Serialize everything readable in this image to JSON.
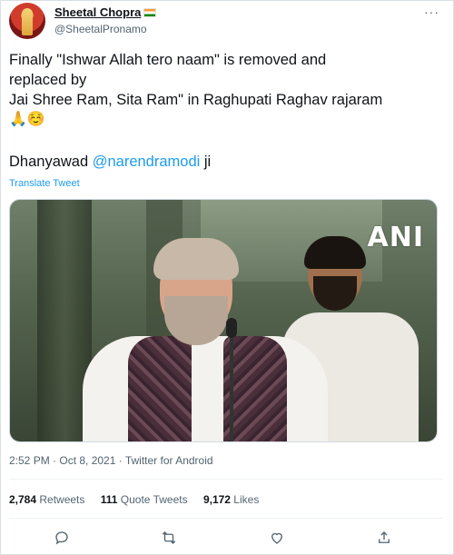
{
  "author": {
    "display_name": "Sheetal Chopra",
    "handle": "@SheetalPronamo"
  },
  "more_label": "···",
  "tweet": {
    "line1": "Finally \"Ishwar Allah tero naam\" is removed and",
    "line2": "replaced by",
    "line3": "Jai Shree Ram, Sita Ram\" in Raghupati Raghav rajaram",
    "emoji": "🙏☺️",
    "thanks_prefix": "Dhanyawad ",
    "mention": "@narendramodi",
    "thanks_suffix": " ji"
  },
  "translate_label": "Translate Tweet",
  "media": {
    "watermark": "ANI"
  },
  "meta": "2:52 PM · Oct 8, 2021 · Twitter for Android",
  "stats": {
    "retweets_count": "2,784",
    "retweets_label": " Retweets",
    "quotes_count": "111",
    "quotes_label": " Quote Tweets",
    "likes_count": "9,172",
    "likes_label": " Likes"
  },
  "actions": [
    "reply-icon",
    "retweet-icon",
    "like-icon",
    "share-icon"
  ],
  "colors": {
    "accent": "#1d9bf0",
    "text": "#0f1419",
    "muted": "#536471"
  }
}
